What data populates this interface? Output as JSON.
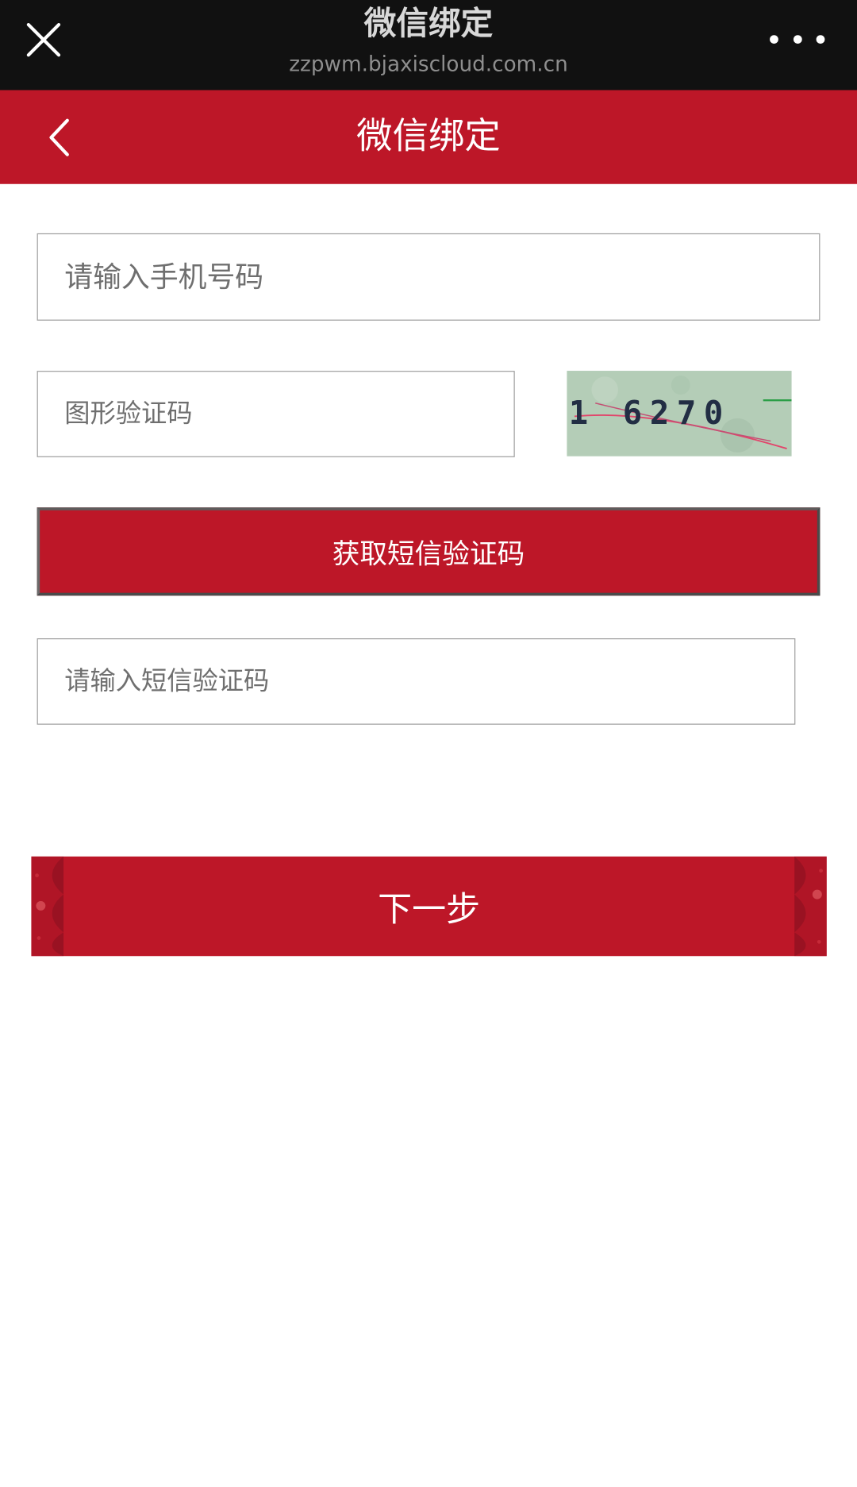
{
  "browser_bar": {
    "title": "微信绑定",
    "url": "zzpwm.bjaxiscloud.com.cn",
    "close_icon": "close-icon",
    "more_icon": "more-dots-icon"
  },
  "header": {
    "title": "微信绑定",
    "back_icon": "chevron-left-icon",
    "background_color": "#bd1728"
  },
  "form": {
    "phone_placeholder": "请输入手机号码",
    "captcha_placeholder": "图形验证码",
    "captcha_image_text": "1 6270",
    "get_sms_button_label": "获取短信验证码",
    "sms_code_placeholder": "请输入短信验证码",
    "next_button_label": "下一步"
  },
  "colors": {
    "accent": "#bd1728",
    "browser_bar": "#111111"
  }
}
